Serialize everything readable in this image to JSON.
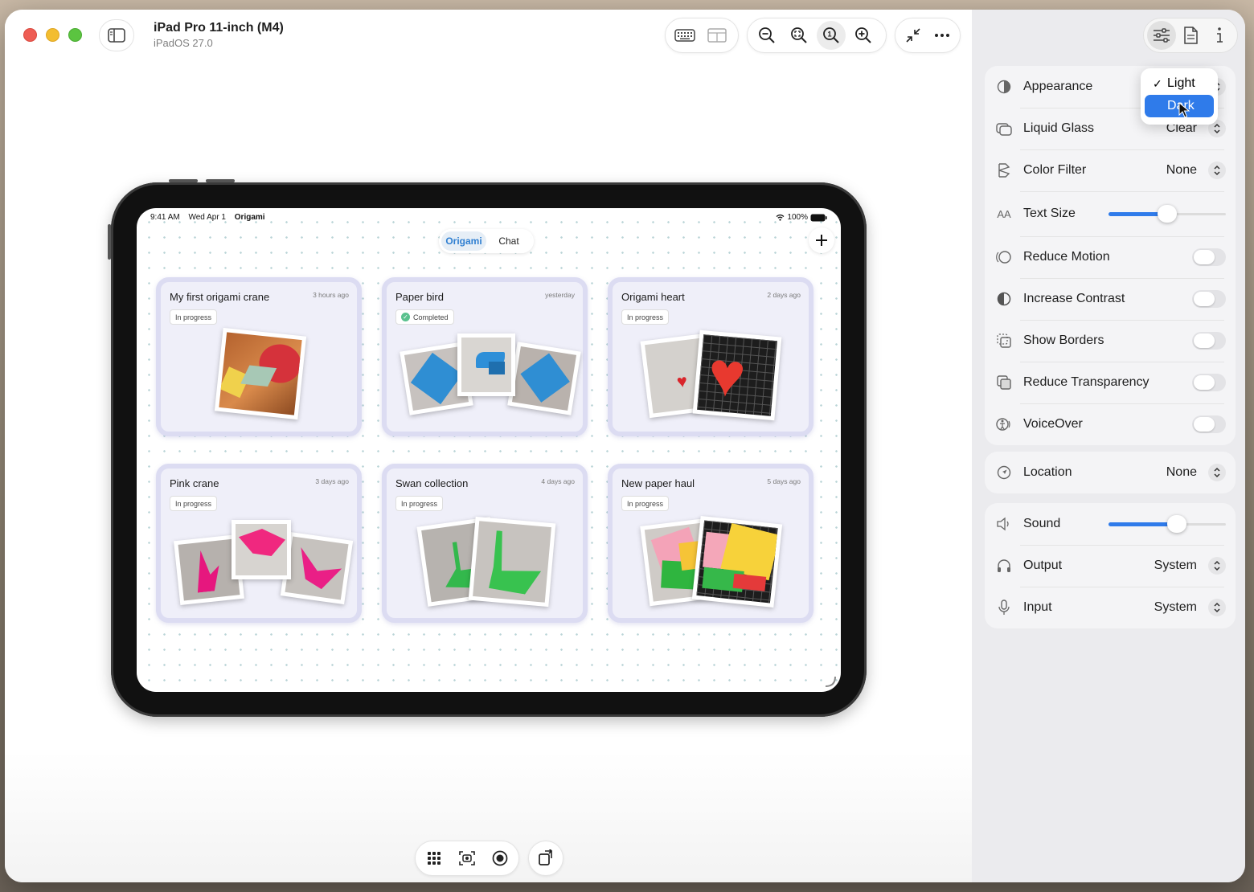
{
  "window": {
    "title": "iPad Pro 11-inch (M4)",
    "subtitle": "iPadOS 27.0"
  },
  "toolbar": {
    "keyboard_icon": "keyboard-icon",
    "layout_icon": "layout-icon",
    "zoom_out_icon": "zoom-out-icon",
    "zoom_fit_icon": "zoom-fit-icon",
    "zoom_actual_icon": "zoom-actual-icon",
    "zoom_in_icon": "zoom-in-icon",
    "collapse_icon": "collapse-icon",
    "more_icon": "more-icon"
  },
  "ipad": {
    "status": {
      "time": "9:41 AM",
      "date": "Wed Apr 1",
      "app": "Origami",
      "battery": "100%"
    },
    "segments": [
      "Origami",
      "Chat"
    ],
    "selected_segment": "Origami",
    "cards": [
      {
        "title": "My first origami crane",
        "time": "3 hours ago",
        "status": "In progress"
      },
      {
        "title": "Paper bird",
        "time": "yesterday",
        "status": "Completed"
      },
      {
        "title": "Origami heart",
        "time": "2 days ago",
        "status": "In progress"
      },
      {
        "title": "Pink crane",
        "time": "3 days ago",
        "status": "In progress"
      },
      {
        "title": "Swan collection",
        "time": "4 days ago",
        "status": "In progress"
      },
      {
        "title": "New paper haul",
        "time": "5 days ago",
        "status": "In progress"
      }
    ]
  },
  "sidebar": {
    "settings": [
      {
        "label": "Appearance",
        "icon": "appearance-icon",
        "control": "select",
        "value": "Dark"
      },
      {
        "label": "Liquid Glass",
        "icon": "liquid-glass-icon",
        "control": "select",
        "value": "Clear"
      },
      {
        "label": "Color Filter",
        "icon": "color-filter-icon",
        "control": "select",
        "value": "None"
      },
      {
        "label": "Text Size",
        "icon": "text-size-icon",
        "control": "slider",
        "level": 0.5
      },
      {
        "label": "Reduce Motion",
        "icon": "reduce-motion-icon",
        "control": "toggle",
        "on": false
      },
      {
        "label": "Increase Contrast",
        "icon": "increase-contrast-icon",
        "control": "toggle",
        "on": false
      },
      {
        "label": "Show Borders",
        "icon": "show-borders-icon",
        "control": "toggle",
        "on": false
      },
      {
        "label": "Reduce Transparency",
        "icon": "reduce-transparency-icon",
        "control": "toggle",
        "on": false
      },
      {
        "label": "VoiceOver",
        "icon": "voiceover-icon",
        "control": "toggle",
        "on": false
      }
    ],
    "location": {
      "label": "Location",
      "value": "None"
    },
    "audio": [
      {
        "label": "Sound",
        "control": "slider",
        "level": 0.58
      },
      {
        "label": "Output",
        "control": "select",
        "value": "System"
      },
      {
        "label": "Input",
        "control": "select",
        "value": "System"
      }
    ],
    "appearance_menu": {
      "options": [
        "Light",
        "Dark"
      ],
      "checked": "Light",
      "highlighted": "Dark"
    }
  },
  "colors": {
    "accent": "#2f7bea",
    "selected_segment_text": "#2f7fd1",
    "completed_badge": "#5ac18e"
  }
}
